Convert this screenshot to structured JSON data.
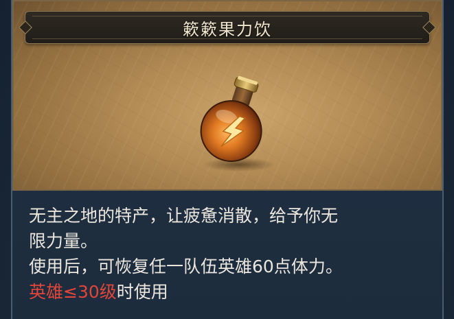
{
  "item": {
    "name": "簌簌果力饮",
    "icon": "potion-bottle-lightning-icon"
  },
  "description": {
    "line1": "无主之地的特产，让疲惫消散，给予你无",
    "line2": "限力量。",
    "line3": "使用后，可恢复任一队伍英雄60点体力。",
    "requirement_red": "英雄≤30级",
    "requirement_tail": "时使用"
  },
  "colors": {
    "requirement": "#e0463a",
    "text": "#ebe7df",
    "title": "#f1e6cf"
  }
}
